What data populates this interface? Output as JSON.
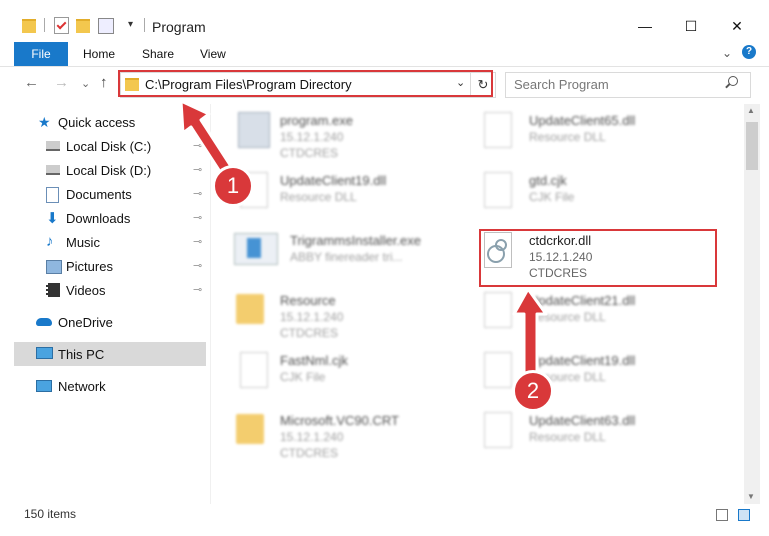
{
  "window": {
    "title": "Program",
    "controls": {
      "minimize": "—",
      "maximize": "☐",
      "close": "✕"
    }
  },
  "ribbon": {
    "tabs": [
      "File",
      "Home",
      "Share",
      "View"
    ],
    "expand_glyph": "⌄",
    "help_glyph": "?"
  },
  "nav": {
    "back_glyph": "←",
    "forward_glyph": "→",
    "recent_glyph": "⌄",
    "up_glyph": "↑",
    "address": "C:\\Program Files\\Program Directory",
    "address_chevron": "⌄",
    "refresh_glyph": "↻",
    "search_placeholder": "Search Program"
  },
  "sidebar": {
    "items": [
      {
        "label": "Quick access",
        "icon": "star-icon"
      },
      {
        "label": "Local Disk (C:)",
        "icon": "drive-icon",
        "pinned": true
      },
      {
        "label": "Local Disk (D:)",
        "icon": "drive-icon",
        "pinned": true
      },
      {
        "label": "Documents",
        "icon": "documents-icon",
        "pinned": true
      },
      {
        "label": "Downloads",
        "icon": "downloads-icon",
        "pinned": true
      },
      {
        "label": "Music",
        "icon": "music-icon",
        "pinned": true
      },
      {
        "label": "Pictures",
        "icon": "pictures-icon",
        "pinned": true
      },
      {
        "label": "Videos",
        "icon": "videos-icon",
        "pinned": true
      },
      {
        "label": "OneDrive",
        "icon": "cloud-icon"
      },
      {
        "label": "This PC",
        "icon": "computer-icon",
        "selected": true
      },
      {
        "label": "Network",
        "icon": "network-icon"
      }
    ],
    "pin_glyph": "📌"
  },
  "files": {
    "left": [
      {
        "name": "program.exe",
        "line1": "15.12.1.240",
        "line2": "CTDCRES"
      },
      {
        "name": "UpdateClient19.dll",
        "line1": "Resource DLL",
        "line2": ""
      },
      {
        "name": "TrigrammsInstaller.exe",
        "line1": "ABBY finereader tri...",
        "line2": ""
      },
      {
        "name": "Resource",
        "line1": "15.12.1.240",
        "line2": "CTDCRES"
      },
      {
        "name": "FastNml.cjk",
        "line1": "CJK File",
        "line2": ""
      },
      {
        "name": "Microsoft.VC90.CRT",
        "line1": "15.12.1.240",
        "line2": "CTDCRES"
      }
    ],
    "right": [
      {
        "name": "UpdateClient65.dll",
        "line1": "Resource DLL",
        "line2": ""
      },
      {
        "name": "gtd.cjk",
        "line1": "CJK File",
        "line2": ""
      },
      {
        "name": "ctdcrkor.dll",
        "line1": "15.12.1.240",
        "line2": "CTDCRES"
      },
      {
        "name": "UpdateClient21.dll",
        "line1": "Resource DLL",
        "line2": ""
      },
      {
        "name": "UpdateClient19.dll",
        "line1": "Resource DLL",
        "line2": ""
      },
      {
        "name": "UpdateClient63.dll",
        "line1": "Resource DLL",
        "line2": ""
      }
    ]
  },
  "status": {
    "count": "150 items"
  },
  "annotations": {
    "step1": "1",
    "step2": "2",
    "color": "#d9383a"
  },
  "colors": {
    "accent": "#1979ca",
    "highlight": "#d9383a"
  }
}
